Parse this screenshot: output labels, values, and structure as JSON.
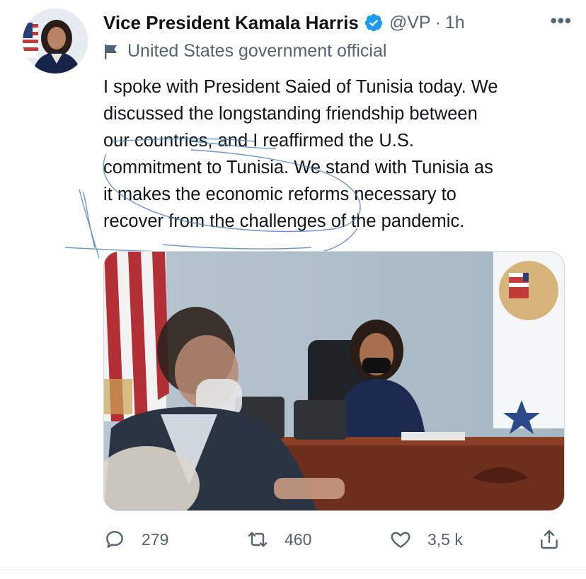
{
  "tweet": {
    "display_name": "Vice President Kamala Harris",
    "handle": "@VP",
    "separator": "·",
    "time": "1h",
    "label": "United States government official",
    "text": "I spoke with President Saied of Tunisia today. We\ndiscussed the longstanding friendship between\nour countries, and I reaffirmed the U.S.\ncommitment to Tunisia. We stand with Tunisia as\nit makes the economic reforms necessary to\nrecover from the challenges of the pandemic.",
    "more_label": "•••"
  },
  "actions": {
    "reply_count": "279",
    "retweet_count": "460",
    "like_count": "3,5 k"
  },
  "icons": {
    "verified": "verified-badge-icon",
    "label": "flag-icon",
    "reply": "reply-icon",
    "retweet": "retweet-icon",
    "like": "heart-icon",
    "share": "share-icon"
  },
  "colors": {
    "verified": "#1d9bf0",
    "secondary_text": "#536471",
    "primary_text": "#0f1419",
    "scribble": "#4a7fc1"
  }
}
